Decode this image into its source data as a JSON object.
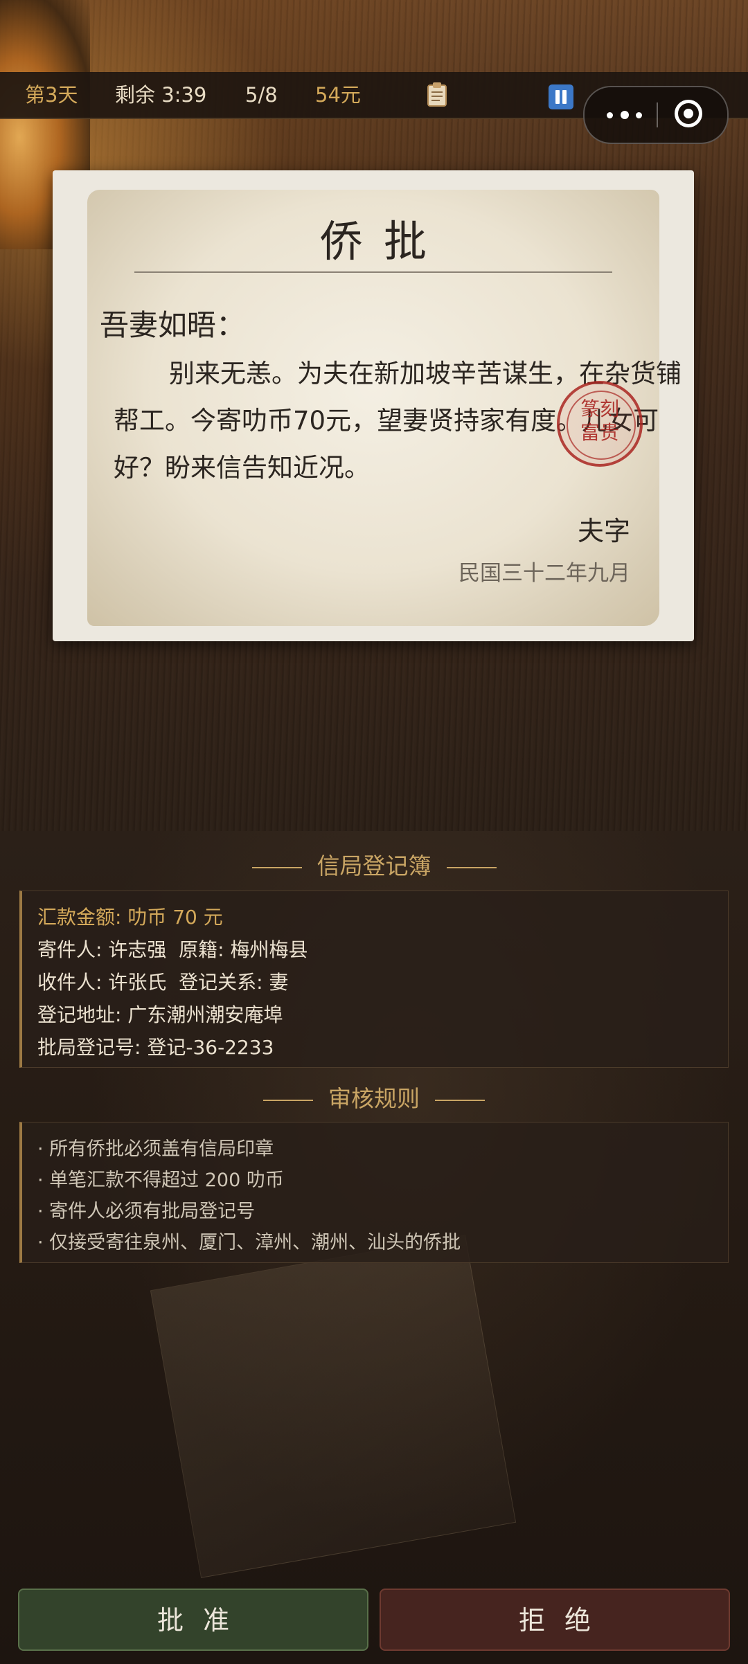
{
  "status_bar": {
    "day": "第3天",
    "time_left": "剩余 3:39",
    "progress": "5/8",
    "money": "54元",
    "clipboard_icon": "clipboard-icon",
    "pause_icon": "pause-icon"
  },
  "capsule": {
    "more_icon": "more-dots-icon",
    "close_icon": "target-close-icon"
  },
  "letter": {
    "title": "侨批",
    "salutation": "吾妻如晤：",
    "body": "别来无恙。为夫在新加坡辛苦谋生，在杂货铺帮工。今寄叻币70元，望妻贤持家有度。儿女可好？盼来信告知近况。",
    "seal_text": "篆刻富贵",
    "signature": "夫字",
    "date": "民国三十二年九月"
  },
  "registry": {
    "title": "信局登记簿",
    "amount": "汇款金额: 叻币 70 元",
    "sender": "寄件人: 许志强  原籍: 梅州梅县",
    "recipient": "收件人: 许张氏  登记关系: 妻",
    "address": "登记地址: 广东潮州潮安庵埠",
    "reg_no": "批局登记号: 登记-36-2233"
  },
  "rules": {
    "title": "审核规则",
    "items": [
      "· 所有侨批必须盖有信局印章",
      "· 单笔汇款不得超过 200 叻币",
      "· 寄件人必须有批局登记号",
      "· 仅接受寄往泉州、厦门、漳州、潮州、汕头的侨批"
    ]
  },
  "actions": {
    "approve": "批准",
    "reject": "拒绝"
  },
  "colors": {
    "accent_gold": "#c9a564",
    "approve_bg": "#33432b",
    "reject_bg": "#46241f",
    "seal_red": "#aa2823"
  }
}
